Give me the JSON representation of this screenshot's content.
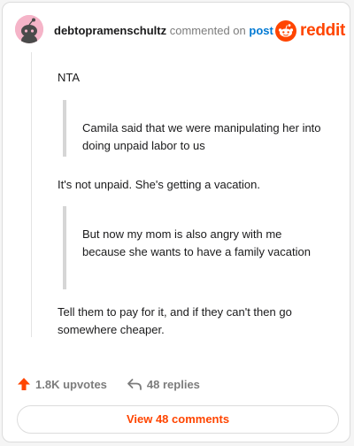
{
  "header": {
    "username": "debtopramenschultz",
    "action_text": "commented on",
    "post_link_text": "post",
    "brand_name": "reddit",
    "brand_color": "#ff4500",
    "avatar_icon": "snoo-avatar-icon"
  },
  "comment": {
    "paragraph_1": "NTA",
    "quote_1": "Camila said that we were manipulating her into doing unpaid labor to us",
    "paragraph_2": "It's not unpaid. She's getting a vacation.",
    "quote_2": "But now my mom is also angry with me because she wants to have a family vacation",
    "paragraph_3": "Tell them to pay for it, and if they can't then go somewhere cheaper."
  },
  "footer": {
    "upvotes_label": "1.8K upvotes",
    "replies_label": "48 replies",
    "view_comments_label": "View 48 comments",
    "upvote_icon": "upvote-arrow-icon",
    "reply_icon": "reply-arrow-icon",
    "upvote_color": "#ff4500"
  }
}
